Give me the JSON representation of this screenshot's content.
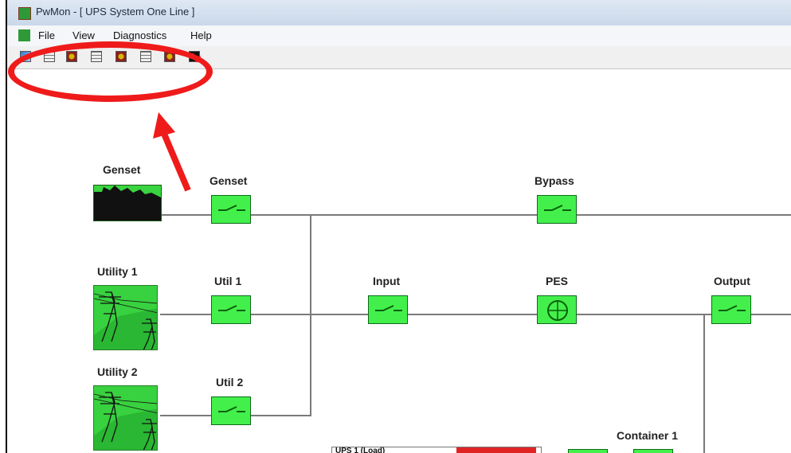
{
  "window": {
    "title": "PwMon - [ UPS System One Line ]"
  },
  "menu": {
    "items": [
      "File",
      "View",
      "Diagnostics",
      "Help"
    ]
  },
  "toolbar": {
    "buttons": [
      {
        "icon": "blue-icon"
      },
      {
        "icon": "grid-icon"
      },
      {
        "icon": "device-icon"
      },
      {
        "icon": "grid-icon"
      },
      {
        "icon": "device-icon"
      },
      {
        "icon": "grid-icon"
      },
      {
        "icon": "device-icon"
      },
      {
        "icon": "waveform-icon"
      }
    ]
  },
  "diagram": {
    "genset_source": "Genset",
    "genset_switch": "Genset",
    "bypass": "Bypass",
    "utility1": "Utility 1",
    "util1": "Util 1",
    "input": "Input",
    "pes": "PES",
    "output": "Output",
    "utility2": "Utility 2",
    "util2": "Util 2",
    "container1": "Container 1",
    "ups_label": "UPS 1 (Load)"
  },
  "colors": {
    "accent": "#43f04b",
    "alert": "#ef1b1b"
  }
}
